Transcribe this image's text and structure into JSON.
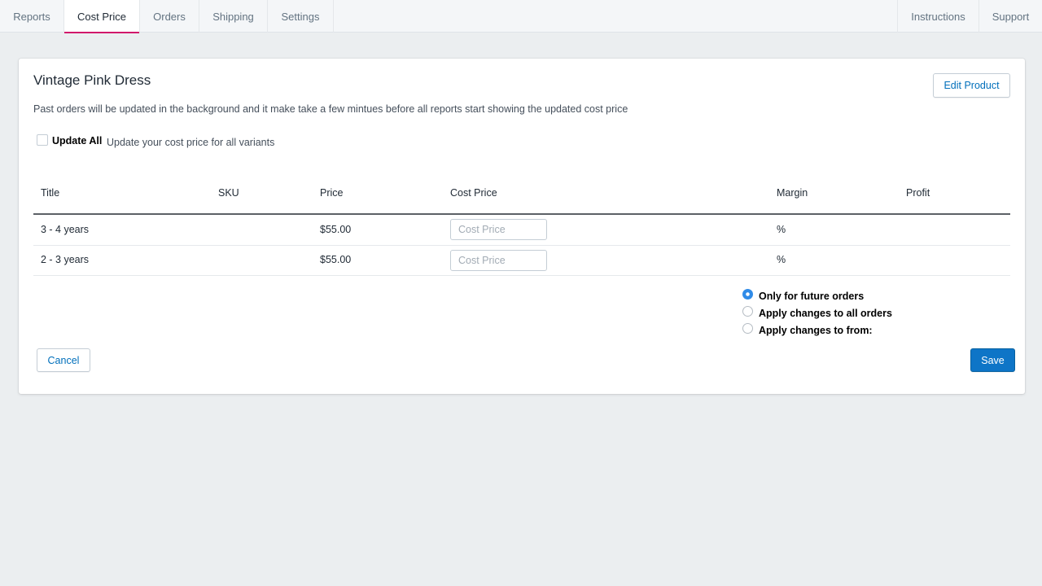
{
  "nav": {
    "tabs": [
      "Reports",
      "Cost Price",
      "Orders",
      "Shipping",
      "Settings"
    ],
    "active_tab": "Cost Price",
    "right_links": [
      "Instructions",
      "Support"
    ],
    "accent_color": "#d1186b"
  },
  "product": {
    "title": "Vintage Pink Dress",
    "edit_button": "Edit Product",
    "note": "Past orders will be updated in the background and it make take a few mintues before all reports start showing the updated cost price"
  },
  "update_all": {
    "label": "Update All",
    "help": "Update your cost price for all variants",
    "checked": false
  },
  "table": {
    "columns": [
      "Title",
      "SKU",
      "Price",
      "Cost Price",
      "Margin",
      "Profit"
    ],
    "rows": [
      {
        "title": "3 - 4 years",
        "sku": "",
        "price": "$55.00",
        "cost_placeholder": "Cost Price",
        "margin": "%",
        "profit": ""
      },
      {
        "title": "2 - 3 years",
        "sku": "",
        "price": "$55.00",
        "cost_placeholder": "Cost Price",
        "margin": "%",
        "profit": ""
      }
    ]
  },
  "apply_options": {
    "options": [
      "Only for future orders",
      "Apply changes to all orders",
      "Apply changes to from:"
    ],
    "selected": "Only for future orders",
    "selected_color": "#2f8be8"
  },
  "actions": {
    "cancel": "Cancel",
    "save": "Save",
    "primary_color": "#0e75c7"
  }
}
